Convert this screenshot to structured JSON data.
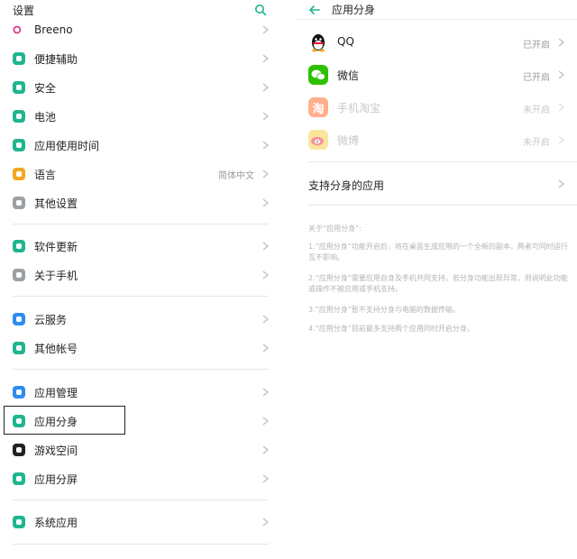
{
  "left": {
    "title": "设置",
    "items": [
      {
        "label": "Breeno",
        "color": "#d8368a"
      },
      {
        "label": "便捷辅助",
        "color": "#1fb58f"
      },
      {
        "label": "安全",
        "color": "#1fb58f"
      },
      {
        "label": "电池",
        "color": "#1fb58f"
      },
      {
        "label": "应用使用时间",
        "color": "#1fb58f"
      },
      {
        "label": "语言",
        "value": "简体中文",
        "color": "#f5a623"
      },
      {
        "label": "其他设置",
        "color": "#9aa0a6"
      },
      {
        "label": "软件更新",
        "color": "#1fb58f"
      },
      {
        "label": "关于手机",
        "color": "#9aa0a6"
      },
      {
        "label": "云服务",
        "color": "#2d8cf0"
      },
      {
        "label": "其他帐号",
        "color": "#1fb58f"
      },
      {
        "label": "应用管理",
        "color": "#2d8cf0"
      },
      {
        "label": "应用分身",
        "color": "#1fb58f"
      },
      {
        "label": "游戏空间",
        "color": "#222222"
      },
      {
        "label": "应用分屏",
        "color": "#1fb58f"
      },
      {
        "label": "系统应用",
        "color": "#1fb58f"
      }
    ]
  },
  "right": {
    "title": "应用分身",
    "apps": [
      {
        "name": "QQ",
        "status": "已开启"
      },
      {
        "name": "微信",
        "status": "已开启"
      },
      {
        "name": "手机淘宝",
        "status": "未开启"
      },
      {
        "name": "微博",
        "status": "未开启"
      }
    ],
    "taobao_glyph": "淘",
    "support_label": "支持分身的应用",
    "notes_title": "关于“应用分身”:",
    "notes": [
      "1.“应用分身”功能开启后，将在桌面生成应用的一个全新的副本，两者可同时运行互不影响。",
      "2.“应用分身”需要应用自身及手机共同支持，若分身功能出现异常，则说明此功能或操作不被应用或手机支持。",
      "3.“应用分身”暂不支持分身与电脑的数据传输。",
      "4.“应用分身”目前最多支持两个应用同时开启分身。"
    ]
  },
  "colors": {
    "accent": "#1fb58f",
    "qq": "#111111",
    "wechat": "#2dc100",
    "taobao": "#ff5000",
    "weibo": "#e6162d"
  }
}
